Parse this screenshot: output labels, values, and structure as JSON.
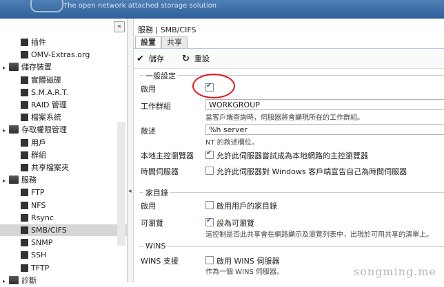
{
  "header": {
    "subtitle": "The open network attached storage solution"
  },
  "sidebar": {
    "collapse_glyph": "«",
    "items": [
      {
        "label": "插件",
        "icon": "puzzle-icon"
      },
      {
        "label": "OMV-Extras.org",
        "icon": "tools-icon"
      },
      {
        "label": "儲存裝置",
        "icon": "folder-icon"
      },
      {
        "label": "實體磁碟",
        "icon": "disk-icon"
      },
      {
        "label": "S.M.A.R.T.",
        "icon": "smart-icon"
      },
      {
        "label": "RAID 管理",
        "icon": "raid-icon"
      },
      {
        "label": "檔案系統",
        "icon": "filesystem-icon"
      },
      {
        "label": "存取權限管理",
        "icon": "folder-icon"
      },
      {
        "label": "用戶",
        "icon": "user-icon"
      },
      {
        "label": "群組",
        "icon": "group-icon"
      },
      {
        "label": "共享檔案夾",
        "icon": "share-icon"
      },
      {
        "label": "服務",
        "icon": "folder-icon"
      },
      {
        "label": "FTP",
        "icon": "ftp-icon"
      },
      {
        "label": "NFS",
        "icon": "nfs-icon"
      },
      {
        "label": "Rsync",
        "icon": "rsync-icon"
      },
      {
        "label": "SMB/CIFS",
        "icon": "windows-icon"
      },
      {
        "label": "SNMP",
        "icon": "snmp-icon"
      },
      {
        "label": "SSH",
        "icon": "ssh-icon"
      },
      {
        "label": "TFTP",
        "icon": "tftp-icon"
      },
      {
        "label": "診斷",
        "icon": "folder-icon"
      }
    ],
    "selected": "SMB/CIFS"
  },
  "main": {
    "breadcrumb": "服務 | SMB/CIFS",
    "tabs": [
      {
        "label": "設置"
      },
      {
        "label": "共享"
      }
    ],
    "toolbar": {
      "save": "儲存",
      "reset": "重設"
    },
    "general": {
      "title": "一般設定",
      "enable_label": "啟用",
      "enable_checked": true,
      "workgroup_label": "工作群組",
      "workgroup_value": "WORKGROUP",
      "workgroup_hint": "當客戶端查詢時，伺服器將會顯現所在的工作群組。",
      "description_label": "敘述",
      "description_value": "%h server",
      "description_hint": "NT 的敘述欄位。",
      "local_master_label": "本地主控瀏覽器",
      "local_master_text": "允許此伺服器嘗試成為本地網路的主控瀏覽器",
      "local_master_checked": true,
      "time_server_label": "時間伺服器",
      "time_server_text": "允許此伺服器對 Windows 客戶端宣告自己為時間伺服器",
      "time_server_checked": false
    },
    "homes": {
      "title": "家目錄",
      "enable_label": "啟用",
      "enable_text": "啟用用戶的家目錄",
      "enable_checked": false,
      "browsable_label": "可瀏覽",
      "browsable_text": "設為可瀏覽",
      "browsable_checked": true,
      "browsable_hint": "這控制是否此共享會在網路顯示及瀏覽列表中，出現於可用共享的清單上。"
    },
    "wins": {
      "title": "WINS",
      "support_label": "WINS 支援",
      "support_text": "啟用 WINS 伺服器",
      "support_checked": false,
      "support_hint": "作為一個 WINS 伺服器。"
    }
  },
  "watermark": "songming.me"
}
